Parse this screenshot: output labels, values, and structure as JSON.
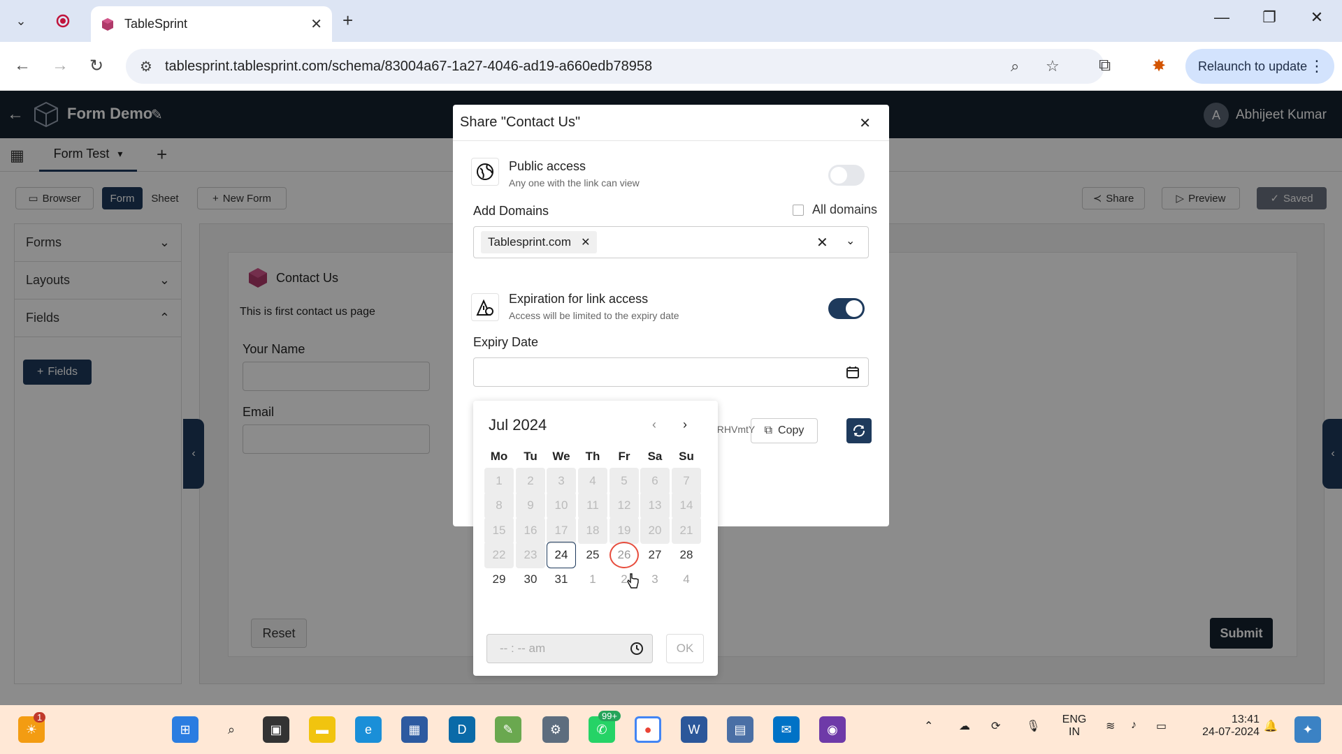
{
  "browser": {
    "tab_title": "TableSprint",
    "url": "tablesprint.tablesprint.com/schema/83004a67-1a27-4046-ad19-a660edb78958",
    "relaunch_label": "Relaunch to update"
  },
  "app": {
    "title": "Form Demo",
    "user_initial": "A",
    "user_name": "Abhijeet Kumar",
    "form_tab": "Form Test"
  },
  "toolbar": {
    "browser": "Browser",
    "form": "Form",
    "sheet": "Sheet",
    "new_form": "New Form",
    "share": "Share",
    "preview": "Preview",
    "saved": "Saved"
  },
  "sidebar": {
    "items": [
      {
        "label": "Forms"
      },
      {
        "label": "Layouts"
      },
      {
        "label": "Fields"
      }
    ],
    "fields_button": "Fields"
  },
  "form": {
    "title": "Contact Us",
    "description": "This is first contact us page",
    "fields": [
      {
        "label": "Your Name"
      },
      {
        "label": "Email"
      }
    ],
    "reset_label": "Reset",
    "submit_label": "Submit"
  },
  "modal": {
    "title": "Share \"Contact Us\"",
    "public_access": {
      "title": "Public access",
      "subtitle": "Any one with the link can view",
      "enabled": false
    },
    "add_domains_label": "Add Domains",
    "all_domains_label": "All domains",
    "domains": [
      "Tablesprint.com"
    ],
    "expiration": {
      "title": "Expiration for link access",
      "subtitle": "Access will be limited to the expiry date",
      "enabled": true
    },
    "expiry_date_label": "Expiry Date",
    "expiry_date_value": "",
    "link_fragment": "2RHVmtY",
    "copy_label": "Copy"
  },
  "picker": {
    "month_label": "Jul 2024",
    "weekdays": [
      "Mo",
      "Tu",
      "We",
      "Th",
      "Fr",
      "Sa",
      "Su"
    ],
    "weeks": [
      [
        {
          "d": "1",
          "s": "dis"
        },
        {
          "d": "2",
          "s": "dis"
        },
        {
          "d": "3",
          "s": "dis"
        },
        {
          "d": "4",
          "s": "dis"
        },
        {
          "d": "5",
          "s": "dis"
        },
        {
          "d": "6",
          "s": "dis"
        },
        {
          "d": "7",
          "s": "dis"
        }
      ],
      [
        {
          "d": "8",
          "s": "dis"
        },
        {
          "d": "9",
          "s": "dis"
        },
        {
          "d": "10",
          "s": "dis"
        },
        {
          "d": "11",
          "s": "dis"
        },
        {
          "d": "12",
          "s": "dis"
        },
        {
          "d": "13",
          "s": "dis"
        },
        {
          "d": "14",
          "s": "dis"
        }
      ],
      [
        {
          "d": "15",
          "s": "dis"
        },
        {
          "d": "16",
          "s": "dis"
        },
        {
          "d": "17",
          "s": "dis"
        },
        {
          "d": "18",
          "s": "dis"
        },
        {
          "d": "19",
          "s": "dis"
        },
        {
          "d": "20",
          "s": "dis"
        },
        {
          "d": "21",
          "s": "dis"
        }
      ],
      [
        {
          "d": "22",
          "s": "dis"
        },
        {
          "d": "23",
          "s": "dis"
        },
        {
          "d": "24",
          "s": "today"
        },
        {
          "d": "25",
          "s": "nrm"
        },
        {
          "d": "26",
          "s": "hover"
        },
        {
          "d": "27",
          "s": "nrm"
        },
        {
          "d": "28",
          "s": "nrm"
        }
      ],
      [
        {
          "d": "29",
          "s": "nrm"
        },
        {
          "d": "30",
          "s": "nrm"
        },
        {
          "d": "31",
          "s": "nrm"
        },
        {
          "d": "1",
          "s": "oth"
        },
        {
          "d": "2",
          "s": "oth"
        },
        {
          "d": "3",
          "s": "oth"
        },
        {
          "d": "4",
          "s": "oth"
        }
      ]
    ],
    "time_placeholder": "-- : -- am",
    "ok_label": "OK"
  },
  "taskbar": {
    "notif_badge": "1",
    "whatsapp_badge": "99+",
    "lang_top": "ENG",
    "lang_bottom": "IN",
    "time": "13:41",
    "date": "24-07-2024"
  },
  "colors": {
    "brand_dark": "#15212f",
    "accent": "#1e3a5c",
    "hover_ring": "#e74c3c"
  }
}
